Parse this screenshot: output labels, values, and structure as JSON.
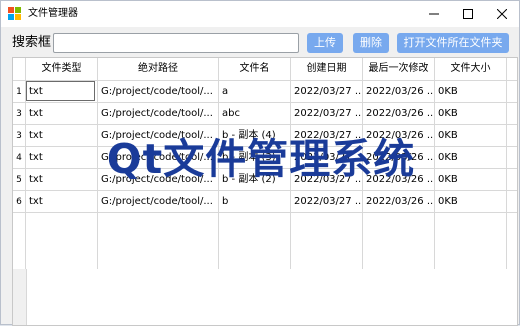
{
  "window": {
    "title": "文件管理器"
  },
  "toolbar": {
    "search_label": "搜索框",
    "search_value": "",
    "upload_label": "上传",
    "delete_label": "删除",
    "open_folder_label": "打开文件所在文件夹"
  },
  "table": {
    "headers": [
      "文件类型",
      "绝对路径",
      "文件名",
      "创建日期",
      "最后一次修改",
      "文件大小"
    ],
    "rows": [
      {
        "num": "1",
        "cells": [
          "txt",
          "G:/project/code/tool/...",
          "a",
          "2022/03/27 ...",
          "2022/03/26 ...",
          "0KB"
        ]
      },
      {
        "num": "3",
        "cells": [
          "txt",
          "G:/project/code/tool/...",
          "abc",
          "2022/03/27 ...",
          "2022/03/26 ...",
          "0KB"
        ]
      },
      {
        "num": "3",
        "cells": [
          "txt",
          "G:/project/code/tool/...",
          "b - 副本 (4)",
          "2022/03/27 ...",
          "2022/03/26 ...",
          "0KB"
        ]
      },
      {
        "num": "4",
        "cells": [
          "txt",
          "G:/project/code/tool/...",
          "b - 副本 (3)",
          "2022/03/27 ...",
          "2022/03/26 ...",
          "0KB"
        ]
      },
      {
        "num": "5",
        "cells": [
          "txt",
          "G:/project/code/tool/...",
          "b - 副本 (2)",
          "2022/03/27 ...",
          "2022/03/26 ...",
          "0KB"
        ]
      },
      {
        "num": "6",
        "cells": [
          "txt",
          "G:/project/code/tool/...",
          "b",
          "2022/03/27 ...",
          "2022/03/26 ...",
          "0KB"
        ]
      }
    ]
  },
  "overlay_text": "Qt文件管理系统",
  "colors": {
    "button_bg": "#78a9ee",
    "overlay": "#1a3b99"
  }
}
